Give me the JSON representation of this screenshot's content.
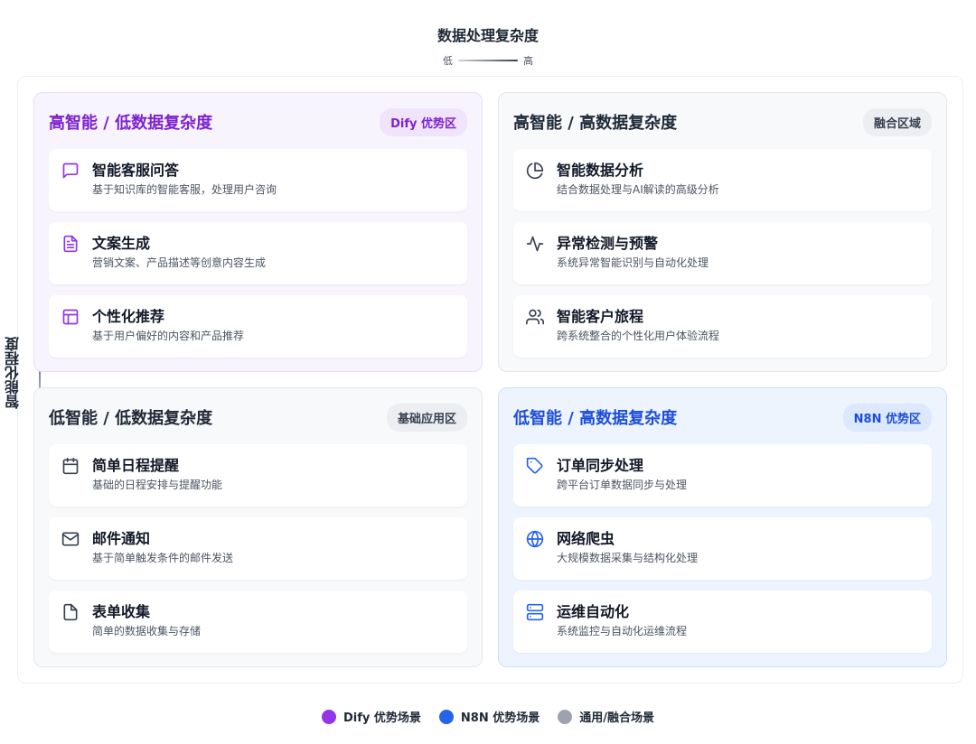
{
  "axes": {
    "top_title": "数据处理复杂度",
    "top_low": "低",
    "top_high": "高",
    "left_title": "智能化程度",
    "left_high": "强",
    "left_low": "弱"
  },
  "quadrants": {
    "tl": {
      "title": "高智能 / 低数据复杂度",
      "tag": "Dify 优势区",
      "items": [
        {
          "icon": "message-square-icon",
          "title": "智能客服问答",
          "desc": "基于知识库的智能客服，处理用户咨询"
        },
        {
          "icon": "file-text-icon",
          "title": "文案生成",
          "desc": "营销文案、产品描述等创意内容生成"
        },
        {
          "icon": "layout-icon",
          "title": "个性化推荐",
          "desc": "基于用户偏好的内容和产品推荐"
        }
      ]
    },
    "tr": {
      "title": "高智能 / 高数据复杂度",
      "tag": "融合区域",
      "items": [
        {
          "icon": "pie-chart-icon",
          "title": "智能数据分析",
          "desc": "结合数据处理与AI解读的高级分析"
        },
        {
          "icon": "activity-icon",
          "title": "异常检测与预警",
          "desc": "系统异常智能识别与自动化处理"
        },
        {
          "icon": "users-icon",
          "title": "智能客户旅程",
          "desc": "跨系统整合的个性化用户体验流程"
        }
      ]
    },
    "bl": {
      "title": "低智能 / 低数据复杂度",
      "tag": "基础应用区",
      "items": [
        {
          "icon": "calendar-icon",
          "title": "简单日程提醒",
          "desc": "基础的日程安排与提醒功能"
        },
        {
          "icon": "mail-icon",
          "title": "邮件通知",
          "desc": "基于简单触发条件的邮件发送"
        },
        {
          "icon": "file-icon",
          "title": "表单收集",
          "desc": "简单的数据收集与存储"
        }
      ]
    },
    "br": {
      "title": "低智能 / 高数据复杂度",
      "tag": "N8N 优势区",
      "items": [
        {
          "icon": "tag-icon",
          "title": "订单同步处理",
          "desc": "跨平台订单数据同步与处理"
        },
        {
          "icon": "globe-icon",
          "title": "网络爬虫",
          "desc": "大规模数据采集与结构化处理"
        },
        {
          "icon": "server-icon",
          "title": "运维自动化",
          "desc": "系统监控与自动化运维流程"
        }
      ]
    }
  },
  "legend": [
    {
      "label": "Dify 优势场景",
      "color": "#9333ea"
    },
    {
      "label": "N8N 优势场景",
      "color": "#2563eb"
    },
    {
      "label": "通用/融合场景",
      "color": "#9ca3af"
    }
  ]
}
